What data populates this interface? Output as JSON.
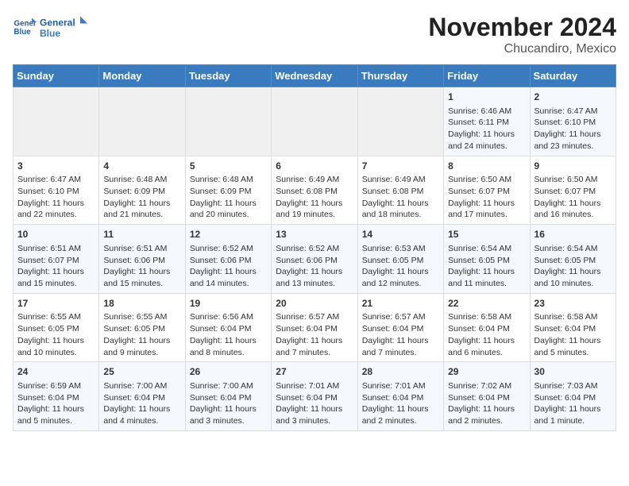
{
  "header": {
    "logo_line1": "General",
    "logo_line2": "Blue",
    "main_title": "November 2024",
    "subtitle": "Chucandiro, Mexico"
  },
  "weekdays": [
    "Sunday",
    "Monday",
    "Tuesday",
    "Wednesday",
    "Thursday",
    "Friday",
    "Saturday"
  ],
  "weeks": [
    [
      {
        "day": "",
        "info": ""
      },
      {
        "day": "",
        "info": ""
      },
      {
        "day": "",
        "info": ""
      },
      {
        "day": "",
        "info": ""
      },
      {
        "day": "",
        "info": ""
      },
      {
        "day": "1",
        "info": "Sunrise: 6:46 AM\nSunset: 6:11 PM\nDaylight: 11 hours and 24 minutes."
      },
      {
        "day": "2",
        "info": "Sunrise: 6:47 AM\nSunset: 6:10 PM\nDaylight: 11 hours and 23 minutes."
      }
    ],
    [
      {
        "day": "3",
        "info": "Sunrise: 6:47 AM\nSunset: 6:10 PM\nDaylight: 11 hours and 22 minutes."
      },
      {
        "day": "4",
        "info": "Sunrise: 6:48 AM\nSunset: 6:09 PM\nDaylight: 11 hours and 21 minutes."
      },
      {
        "day": "5",
        "info": "Sunrise: 6:48 AM\nSunset: 6:09 PM\nDaylight: 11 hours and 20 minutes."
      },
      {
        "day": "6",
        "info": "Sunrise: 6:49 AM\nSunset: 6:08 PM\nDaylight: 11 hours and 19 minutes."
      },
      {
        "day": "7",
        "info": "Sunrise: 6:49 AM\nSunset: 6:08 PM\nDaylight: 11 hours and 18 minutes."
      },
      {
        "day": "8",
        "info": "Sunrise: 6:50 AM\nSunset: 6:07 PM\nDaylight: 11 hours and 17 minutes."
      },
      {
        "day": "9",
        "info": "Sunrise: 6:50 AM\nSunset: 6:07 PM\nDaylight: 11 hours and 16 minutes."
      }
    ],
    [
      {
        "day": "10",
        "info": "Sunrise: 6:51 AM\nSunset: 6:07 PM\nDaylight: 11 hours and 15 minutes."
      },
      {
        "day": "11",
        "info": "Sunrise: 6:51 AM\nSunset: 6:06 PM\nDaylight: 11 hours and 15 minutes."
      },
      {
        "day": "12",
        "info": "Sunrise: 6:52 AM\nSunset: 6:06 PM\nDaylight: 11 hours and 14 minutes."
      },
      {
        "day": "13",
        "info": "Sunrise: 6:52 AM\nSunset: 6:06 PM\nDaylight: 11 hours and 13 minutes."
      },
      {
        "day": "14",
        "info": "Sunrise: 6:53 AM\nSunset: 6:05 PM\nDaylight: 11 hours and 12 minutes."
      },
      {
        "day": "15",
        "info": "Sunrise: 6:54 AM\nSunset: 6:05 PM\nDaylight: 11 hours and 11 minutes."
      },
      {
        "day": "16",
        "info": "Sunrise: 6:54 AM\nSunset: 6:05 PM\nDaylight: 11 hours and 10 minutes."
      }
    ],
    [
      {
        "day": "17",
        "info": "Sunrise: 6:55 AM\nSunset: 6:05 PM\nDaylight: 11 hours and 10 minutes."
      },
      {
        "day": "18",
        "info": "Sunrise: 6:55 AM\nSunset: 6:05 PM\nDaylight: 11 hours and 9 minutes."
      },
      {
        "day": "19",
        "info": "Sunrise: 6:56 AM\nSunset: 6:04 PM\nDaylight: 11 hours and 8 minutes."
      },
      {
        "day": "20",
        "info": "Sunrise: 6:57 AM\nSunset: 6:04 PM\nDaylight: 11 hours and 7 minutes."
      },
      {
        "day": "21",
        "info": "Sunrise: 6:57 AM\nSunset: 6:04 PM\nDaylight: 11 hours and 7 minutes."
      },
      {
        "day": "22",
        "info": "Sunrise: 6:58 AM\nSunset: 6:04 PM\nDaylight: 11 hours and 6 minutes."
      },
      {
        "day": "23",
        "info": "Sunrise: 6:58 AM\nSunset: 6:04 PM\nDaylight: 11 hours and 5 minutes."
      }
    ],
    [
      {
        "day": "24",
        "info": "Sunrise: 6:59 AM\nSunset: 6:04 PM\nDaylight: 11 hours and 5 minutes."
      },
      {
        "day": "25",
        "info": "Sunrise: 7:00 AM\nSunset: 6:04 PM\nDaylight: 11 hours and 4 minutes."
      },
      {
        "day": "26",
        "info": "Sunrise: 7:00 AM\nSunset: 6:04 PM\nDaylight: 11 hours and 3 minutes."
      },
      {
        "day": "27",
        "info": "Sunrise: 7:01 AM\nSunset: 6:04 PM\nDaylight: 11 hours and 3 minutes."
      },
      {
        "day": "28",
        "info": "Sunrise: 7:01 AM\nSunset: 6:04 PM\nDaylight: 11 hours and 2 minutes."
      },
      {
        "day": "29",
        "info": "Sunrise: 7:02 AM\nSunset: 6:04 PM\nDaylight: 11 hours and 2 minutes."
      },
      {
        "day": "30",
        "info": "Sunrise: 7:03 AM\nSunset: 6:04 PM\nDaylight: 11 hours and 1 minute."
      }
    ]
  ]
}
